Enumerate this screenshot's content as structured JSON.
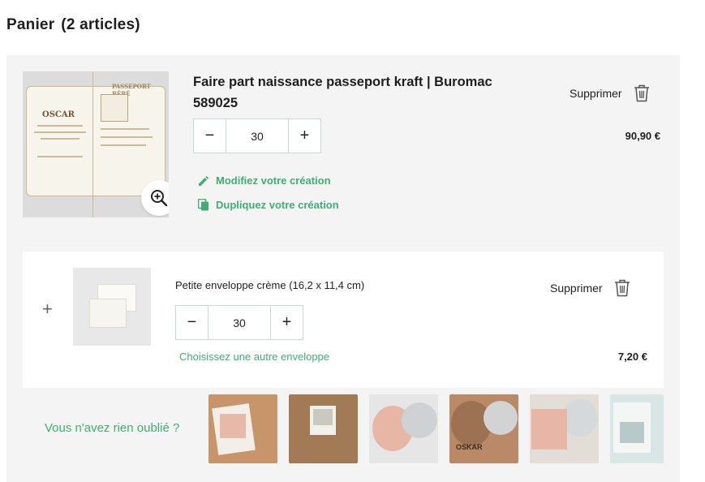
{
  "header": {
    "title": "Panier",
    "count": "(2 articles)"
  },
  "product": {
    "name": "Faire part naissance passeport kraft | Buromac 589025",
    "thumb_text_oscar": "OSCAR",
    "thumb_text_passport": "PASSEPORT BÉBÉ",
    "quantity": "30",
    "price": "90,90 €",
    "delete_label": "Supprimer",
    "modify_label": "Modifiez votre création",
    "duplicate_label": "Dupliquez votre création"
  },
  "envelope": {
    "name": "Petite enveloppe crème (16,2 x 11,4 cm)",
    "quantity": "30",
    "price": "7,20 €",
    "delete_label": "Supprimer",
    "choose_label": "Choisissez une autre enveloppe",
    "plus_symbol": "+"
  },
  "suggestions": {
    "label": "Vous n'avez rien oublié ?",
    "s4_text": "OSKAR"
  },
  "stepper": {
    "minus": "−",
    "plus": "+"
  },
  "colors": {
    "accent": "#3fae76",
    "panel": "#f3f4f3",
    "border": "#c9d9d2"
  }
}
